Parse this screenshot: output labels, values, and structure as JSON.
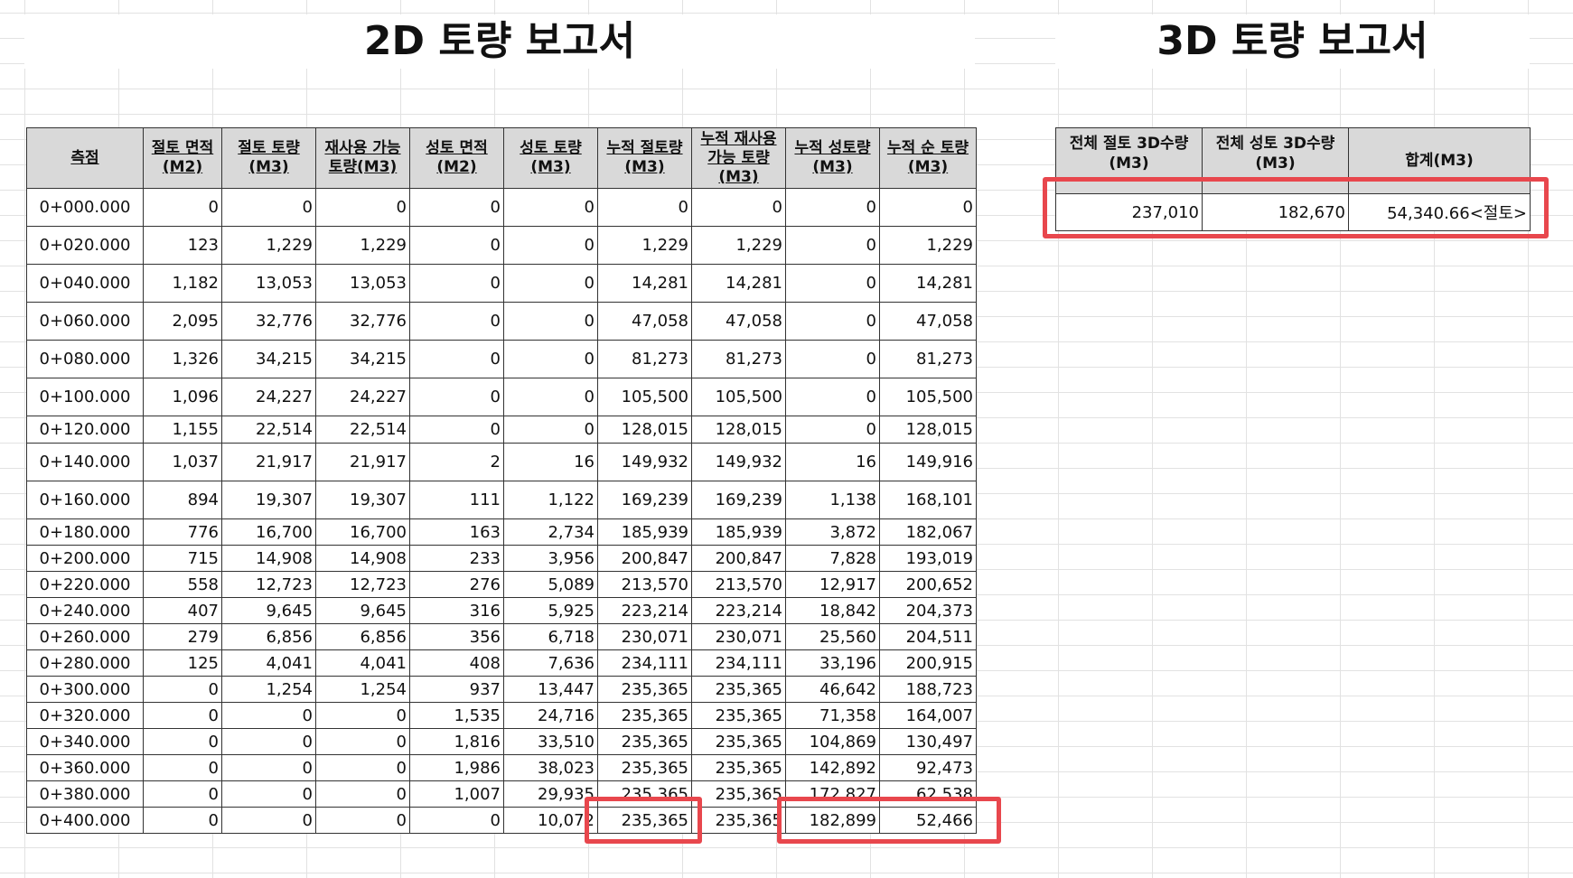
{
  "title_2d": "2D 토량 보고서",
  "title_3d": "3D 토량 보고서",
  "table_2d": {
    "headers": [
      "측점",
      "절토 면적 (M2)",
      "절토 토량 (M3)",
      "재사용 가능 토량(M3)",
      "성토 면적 (M2)",
      "성토 토량 (M3)",
      "누적 절토량 (M3)",
      "누적 재사용 가능 토량 (M3)",
      "누적 성토량 (M3)",
      "누적 순 토량 (M3)"
    ],
    "rows": [
      [
        "0+000.000",
        "0",
        "0",
        "0",
        "0",
        "0",
        "0",
        "0",
        "0",
        "0"
      ],
      [
        "0+020.000",
        "123",
        "1,229",
        "1,229",
        "0",
        "0",
        "1,229",
        "1,229",
        "0",
        "1,229"
      ],
      [
        "0+040.000",
        "1,182",
        "13,053",
        "13,053",
        "0",
        "0",
        "14,281",
        "14,281",
        "0",
        "14,281"
      ],
      [
        "0+060.000",
        "2,095",
        "32,776",
        "32,776",
        "0",
        "0",
        "47,058",
        "47,058",
        "0",
        "47,058"
      ],
      [
        "0+080.000",
        "1,326",
        "34,215",
        "34,215",
        "0",
        "0",
        "81,273",
        "81,273",
        "0",
        "81,273"
      ],
      [
        "0+100.000",
        "1,096",
        "24,227",
        "24,227",
        "0",
        "0",
        "105,500",
        "105,500",
        "0",
        "105,500"
      ],
      [
        "0+120.000",
        "1,155",
        "22,514",
        "22,514",
        "0",
        "0",
        "128,015",
        "128,015",
        "0",
        "128,015"
      ],
      [
        "0+140.000",
        "1,037",
        "21,917",
        "21,917",
        "2",
        "16",
        "149,932",
        "149,932",
        "16",
        "149,916"
      ],
      [
        "0+160.000",
        "894",
        "19,307",
        "19,307",
        "111",
        "1,122",
        "169,239",
        "169,239",
        "1,138",
        "168,101"
      ],
      [
        "0+180.000",
        "776",
        "16,700",
        "16,700",
        "163",
        "2,734",
        "185,939",
        "185,939",
        "3,872",
        "182,067"
      ],
      [
        "0+200.000",
        "715",
        "14,908",
        "14,908",
        "233",
        "3,956",
        "200,847",
        "200,847",
        "7,828",
        "193,019"
      ],
      [
        "0+220.000",
        "558",
        "12,723",
        "12,723",
        "276",
        "5,089",
        "213,570",
        "213,570",
        "12,917",
        "200,652"
      ],
      [
        "0+240.000",
        "407",
        "9,645",
        "9,645",
        "316",
        "5,925",
        "223,214",
        "223,214",
        "18,842",
        "204,373"
      ],
      [
        "0+260.000",
        "279",
        "6,856",
        "6,856",
        "356",
        "6,718",
        "230,071",
        "230,071",
        "25,560",
        "204,511"
      ],
      [
        "0+280.000",
        "125",
        "4,041",
        "4,041",
        "408",
        "7,636",
        "234,111",
        "234,111",
        "33,196",
        "200,915"
      ],
      [
        "0+300.000",
        "0",
        "1,254",
        "1,254",
        "937",
        "13,447",
        "235,365",
        "235,365",
        "46,642",
        "188,723"
      ],
      [
        "0+320.000",
        "0",
        "0",
        "0",
        "1,535",
        "24,716",
        "235,365",
        "235,365",
        "71,358",
        "164,007"
      ],
      [
        "0+340.000",
        "0",
        "0",
        "0",
        "1,816",
        "33,510",
        "235,365",
        "235,365",
        "104,869",
        "130,497"
      ],
      [
        "0+360.000",
        "0",
        "0",
        "0",
        "1,986",
        "38,023",
        "235,365",
        "235,365",
        "142,892",
        "92,473"
      ],
      [
        "0+380.000",
        "0",
        "0",
        "0",
        "1,007",
        "29,935",
        "235,365",
        "235,365",
        "172,827",
        "62,538"
      ],
      [
        "0+400.000",
        "0",
        "0",
        "0",
        "0",
        "10,072",
        "235,365",
        "235,365",
        "182,899",
        "52,466"
      ]
    ]
  },
  "table_3d": {
    "headers": [
      "전체 절토 3D수량 (M3)",
      "전체 성토 3D수량 (M3)",
      "합계(M3)"
    ],
    "values": [
      "237,010",
      "182,670",
      "54,340.66<절토>"
    ]
  },
  "highlight_color": "#e8474d"
}
